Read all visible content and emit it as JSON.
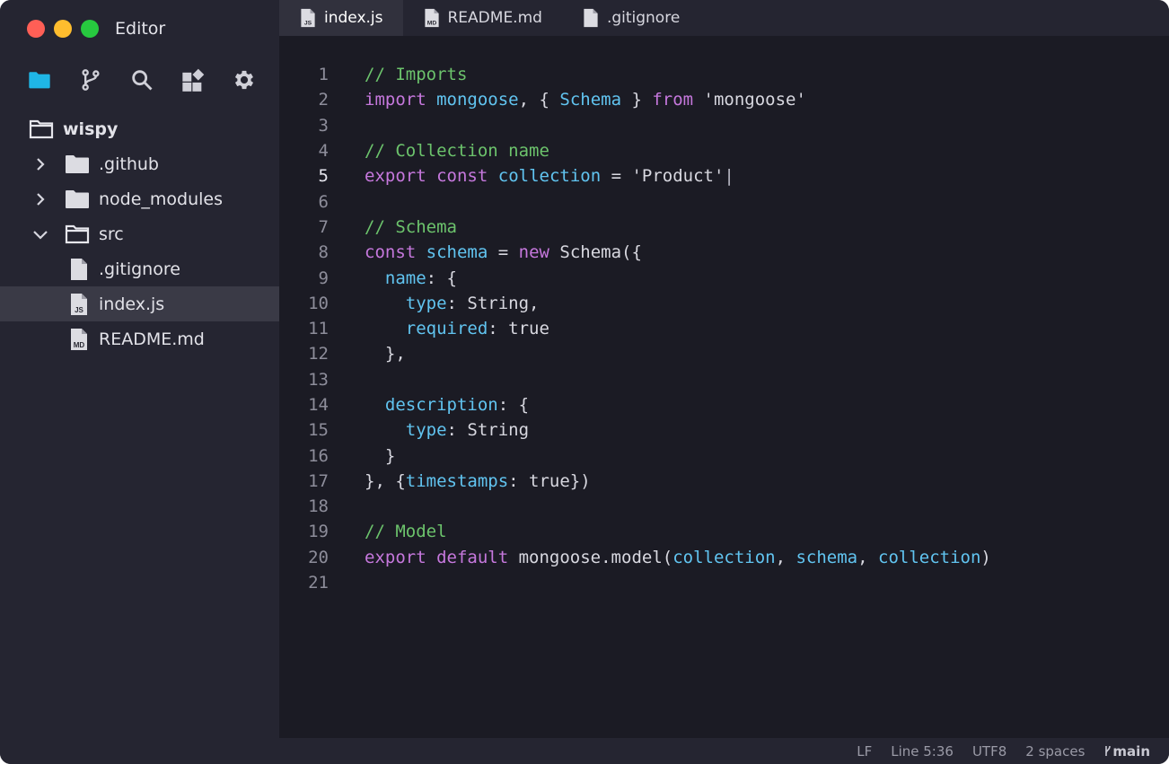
{
  "app": {
    "title": "Editor"
  },
  "colors": {
    "accent": "#1fb6e6",
    "keyword": "#c678dd",
    "identifier": "#61c4f0",
    "comment": "#6cc36c"
  },
  "activity_bar": [
    {
      "icon": "folder-icon",
      "active": true
    },
    {
      "icon": "source-control-icon",
      "active": false
    },
    {
      "icon": "search-icon",
      "active": false
    },
    {
      "icon": "extensions-icon",
      "active": false
    },
    {
      "icon": "gear-icon",
      "active": false
    }
  ],
  "explorer": {
    "root": "wispy",
    "items": [
      {
        "label": ".github",
        "type": "folder",
        "expanded": false
      },
      {
        "label": "node_modules",
        "type": "folder",
        "expanded": false
      },
      {
        "label": "src",
        "type": "folder",
        "expanded": true
      },
      {
        "label": ".gitignore",
        "type": "file",
        "badge": ""
      },
      {
        "label": "index.js",
        "type": "file",
        "badge": "JS",
        "active": true
      },
      {
        "label": "README.md",
        "type": "file",
        "badge": "MD"
      }
    ]
  },
  "tabs": [
    {
      "label": "index.js",
      "badge": "JS",
      "active": true
    },
    {
      "label": "README.md",
      "badge": "MD",
      "active": false
    },
    {
      "label": ".gitignore",
      "badge": "",
      "active": false
    }
  ],
  "code": {
    "current_line": 5,
    "line_numbers": [
      "1",
      "2",
      "3",
      "4",
      "5",
      "6",
      "7",
      "8",
      "9",
      "10",
      "11",
      "12",
      "13",
      "14",
      "15",
      "16",
      "17",
      "18",
      "19",
      "20",
      "21"
    ],
    "tokens": {
      "l1": [
        "// Imports"
      ],
      "l2": [
        "import",
        " ",
        "mongoose",
        ", { ",
        "Schema",
        " } ",
        "from",
        " 'mongoose'"
      ],
      "l4": [
        "// Collection name"
      ],
      "l5": [
        "export",
        " ",
        "const",
        " ",
        "collection",
        " = 'Product'",
        "|"
      ],
      "l7": [
        "// Schema"
      ],
      "l8": [
        "const",
        " ",
        "schema",
        " = ",
        "new",
        " Schema({"
      ],
      "l9": [
        "  ",
        "name",
        ": {"
      ],
      "l10": [
        "    ",
        "type",
        ": String,"
      ],
      "l11": [
        "    ",
        "required",
        ": true"
      ],
      "l12": [
        "  },"
      ],
      "l14": [
        "  ",
        "description",
        ": {"
      ],
      "l15": [
        "    ",
        "type",
        ": String"
      ],
      "l16": [
        "  }"
      ],
      "l17": [
        "}, {",
        "timestamps",
        ": true})"
      ],
      "l19": [
        "// Model"
      ],
      "l20": [
        "export",
        " ",
        "default",
        " mongoose.model(",
        "collection",
        ", ",
        "schema",
        ", ",
        "collection",
        ")"
      ]
    }
  },
  "status_bar": {
    "eol": "LF",
    "position": "Line 5:36",
    "encoding": "UTF8",
    "indent": "2 spaces",
    "branch_icon": "git-branch-icon",
    "branch": "main"
  }
}
